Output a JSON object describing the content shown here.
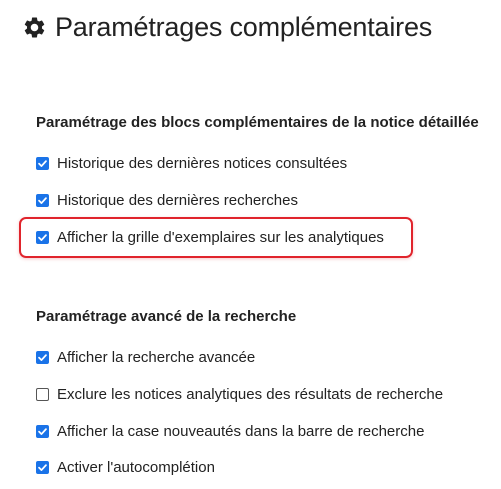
{
  "page": {
    "title": "Paramétrages complémentaires",
    "title_icon": "gear-icon"
  },
  "sections": [
    {
      "heading": "Paramétrage des blocs complémentaires de la notice détaillée",
      "options": [
        {
          "label": "Historique des dernières notices consultées",
          "checked": true
        },
        {
          "label": "Historique des dernières recherches",
          "checked": true
        },
        {
          "label": "Afficher la grille d'exemplaires sur les analytiques",
          "checked": true,
          "highlighted": true
        }
      ]
    },
    {
      "heading": "Paramétrage avancé de la recherche",
      "options": [
        {
          "label": "Afficher la recherche avancée",
          "checked": true
        },
        {
          "label": "Exclure les notices analytiques des résultats de recherche",
          "checked": false
        },
        {
          "label": "Afficher la case nouveautés dans la barre de recherche",
          "checked": true
        },
        {
          "label": "Activer l'autocomplétion",
          "checked": true
        }
      ]
    }
  ],
  "colors": {
    "checkbox_checked": "#1a73e8",
    "highlight_border": "#e0242c",
    "text": "#222222"
  }
}
